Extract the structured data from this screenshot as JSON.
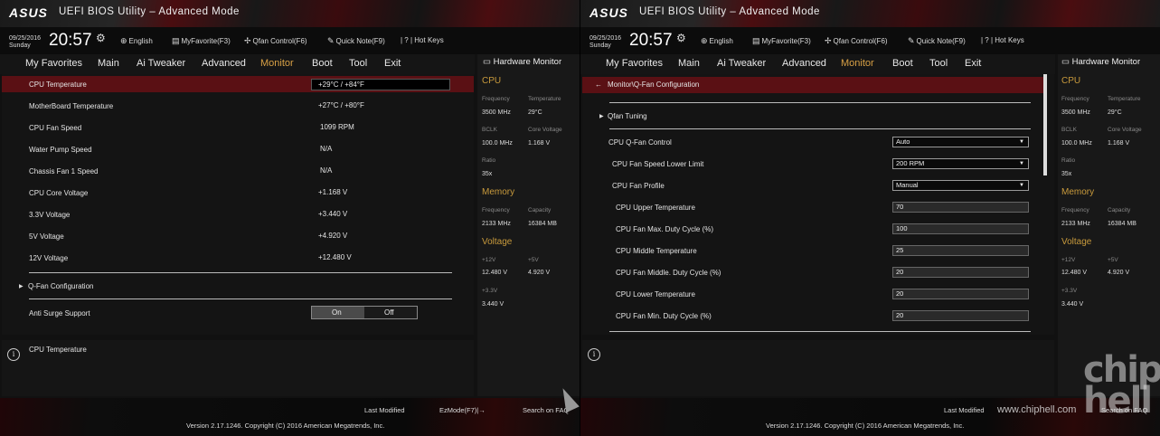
{
  "header": {
    "brand": "ASUS",
    "app_title": "UEFI BIOS Utility – Advanced Mode",
    "date": "09/25/2016 Sunday",
    "time": "20:57",
    "language": "English",
    "myfavorite": "MyFavorite(F3)",
    "qfan": "Qfan Control(F6)",
    "quicknote": "Quick Note(F9)",
    "hotkeys": "| ? | Hot Keys",
    "icons": {
      "gear": "gear-icon",
      "globe": "globe-icon",
      "favorite": "favorite-icon",
      "fan": "fan-icon",
      "note": "note-icon"
    }
  },
  "menu": [
    "My Favorites",
    "Main",
    "Ai Tweaker",
    "Advanced",
    "Monitor",
    "Boot",
    "Tool",
    "Exit"
  ],
  "active_menu": "Monitor",
  "left": {
    "rows": [
      {
        "label": "CPU Temperature",
        "value": "+29°C / +84°F"
      },
      {
        "label": "MotherBoard Temperature",
        "value": "+27°C / +80°F"
      },
      {
        "label": "CPU Fan Speed",
        "value": "1099 RPM"
      },
      {
        "label": "Water Pump Speed",
        "value": "N/A"
      },
      {
        "label": "Chassis Fan 1 Speed",
        "value": "N/A"
      },
      {
        "label": "CPU Core Voltage",
        "value": "+1.168 V"
      },
      {
        "label": "3.3V Voltage",
        "value": "+3.440 V"
      },
      {
        "label": "5V Voltage",
        "value": "+4.920 V"
      },
      {
        "label": "12V Voltage",
        "value": "+12.480 V"
      }
    ],
    "submenu": "Q-Fan Configuration",
    "anti_surge": {
      "label": "Anti Surge Support",
      "on": "On",
      "off": "Off"
    },
    "help_text": "CPU Temperature"
  },
  "right": {
    "breadcrumb": "Monitor\\Q-Fan Configuration",
    "submenu": "Qfan Tuning",
    "controls": [
      {
        "label": "CPU Q-Fan Control",
        "value": "Auto",
        "type": "select"
      },
      {
        "label": "CPU Fan Speed Lower Limit",
        "value": "200 RPM",
        "type": "select"
      },
      {
        "label": "CPU Fan Profile",
        "value": "Manual",
        "type": "select"
      },
      {
        "label": "CPU Upper Temperature",
        "value": "70",
        "type": "input"
      },
      {
        "label": "CPU Fan Max. Duty Cycle (%)",
        "value": "100",
        "type": "input"
      },
      {
        "label": "CPU Middle Temperature",
        "value": "25",
        "type": "input"
      },
      {
        "label": "CPU Fan Middle. Duty Cycle (%)",
        "value": "20",
        "type": "input"
      },
      {
        "label": "CPU Lower Temperature",
        "value": "20",
        "type": "input"
      },
      {
        "label": "CPU Fan Min. Duty Cycle (%)",
        "value": "20",
        "type": "input"
      }
    ],
    "watermark_site": "www.chiphell.com",
    "watermark_logo": "chip hell"
  },
  "hwmon": {
    "title": "Hardware Monitor",
    "cpu": {
      "title": "CPU",
      "freq_label": "Frequency",
      "freq": "3500 MHz",
      "temp_label": "Temperature",
      "temp": "29°C",
      "bclk_label": "BCLK",
      "bclk": "100.0 MHz",
      "vcore_label": "Core Voltage",
      "vcore": "1.168 V",
      "ratio_label": "Ratio",
      "ratio": "35x"
    },
    "memory": {
      "title": "Memory",
      "freq_label": "Frequency",
      "freq": "2133 MHz",
      "cap_label": "Capacity",
      "cap": "16384 MB"
    },
    "voltage": {
      "title": "Voltage",
      "v12_label": "+12V",
      "v12": "12.480 V",
      "v5_label": "+5V",
      "v5": "4.920 V",
      "v33_label": "+3.3V",
      "v33": "3.440 V"
    }
  },
  "footer": {
    "last_modified": "Last Modified",
    "ezmode": "EzMode(F7)|→",
    "search": "Search on FAQ",
    "version": "Version 2.17.1246. Copyright (C) 2016 American Megatrends, Inc."
  }
}
